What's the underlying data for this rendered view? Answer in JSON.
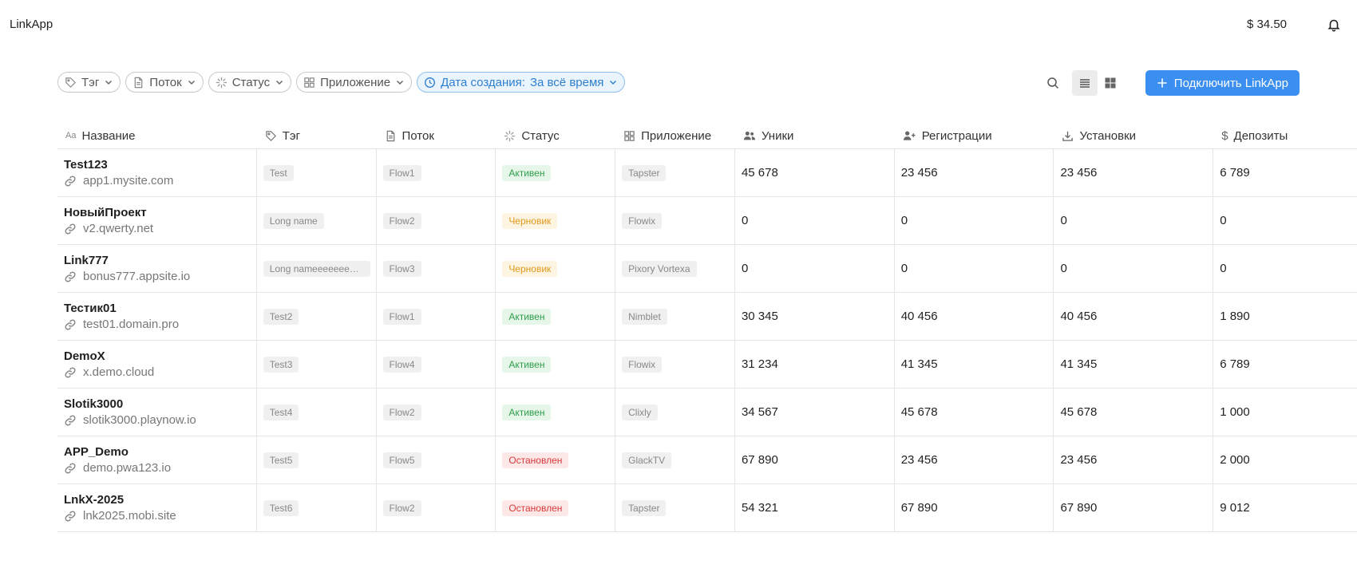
{
  "app": {
    "title": "LinkApp",
    "balance": "$ 34.50"
  },
  "filters": [
    {
      "label": "Тэг",
      "icon": "tag-icon"
    },
    {
      "label": "Поток",
      "icon": "document-icon"
    },
    {
      "label": "Статус",
      "icon": "loader-icon"
    },
    {
      "label": "Приложение",
      "icon": "grid-icon"
    }
  ],
  "date_filter": {
    "label": "Дата создания:",
    "value": "За всё время",
    "icon": "clock-icon"
  },
  "toolbar": {
    "connect_label": "Подключить LinkApp"
  },
  "columns": {
    "name": "Название",
    "tag": "Тэг",
    "flow": "Поток",
    "status": "Статус",
    "app": "Приложение",
    "uniques": "Уники",
    "registrations": "Регистрации",
    "installs": "Установки",
    "deposits": "Депозиты"
  },
  "rows": [
    {
      "name": "Test123",
      "url": "app1.mysite.com",
      "tag": "Test",
      "flow": "Flow1",
      "status": "Активен",
      "status_kind": "active",
      "app": "Tapster",
      "uniques": "45 678",
      "registrations": "23 456",
      "installs": "23 456",
      "deposits": "6 789"
    },
    {
      "name": "НовыйПроект",
      "url": "v2.qwerty.net",
      "tag": "Long name",
      "flow": "Flow2",
      "status": "Черновик",
      "status_kind": "draft",
      "app": "Flowix",
      "uniques": "0",
      "registrations": "0",
      "installs": "0",
      "deposits": "0"
    },
    {
      "name": "Link777",
      "url": "bonus777.appsite.io",
      "tag": "Long nameeeeeeeeeeeee",
      "flow": "Flow3",
      "status": "Черновик",
      "status_kind": "draft",
      "app": "Pixory Vortexa",
      "uniques": "0",
      "registrations": "0",
      "installs": "0",
      "deposits": "0"
    },
    {
      "name": "Тестик01",
      "url": "test01.domain.pro",
      "tag": "Test2",
      "flow": "Flow1",
      "status": "Активен",
      "status_kind": "active",
      "app": "Nimblet",
      "uniques": "30 345",
      "registrations": "40 456",
      "installs": "40 456",
      "deposits": "1 890"
    },
    {
      "name": "DemoX",
      "url": "x.demo.cloud",
      "tag": "Test3",
      "flow": "Flow4",
      "status": "Активен",
      "status_kind": "active",
      "app": "Flowix",
      "uniques": "31 234",
      "registrations": "41 345",
      "installs": "41 345",
      "deposits": "6 789"
    },
    {
      "name": "Slotik3000",
      "url": "slotik3000.playnow.io",
      "tag": "Test4",
      "flow": "Flow2",
      "status": "Активен",
      "status_kind": "active",
      "app": "Clixly",
      "uniques": "34 567",
      "registrations": "45 678",
      "installs": "45 678",
      "deposits": "1 000"
    },
    {
      "name": "APP_Demo",
      "url": "demo.pwa123.io",
      "tag": "Test5",
      "flow": "Flow5",
      "status": "Остановлен",
      "status_kind": "stopped",
      "app": "GlackTV",
      "uniques": "67 890",
      "registrations": "23 456",
      "installs": "23 456",
      "deposits": "2 000"
    },
    {
      "name": "LnkX-2025",
      "url": "lnk2025.mobi.site",
      "tag": "Test6",
      "flow": "Flow2",
      "status": "Остановлен",
      "status_kind": "stopped",
      "app": "Tapster",
      "uniques": "54 321",
      "registrations": "67 890",
      "installs": "67 890",
      "deposits": "9 012"
    }
  ],
  "colors": {
    "accent": "#3b8ff0",
    "active": "#2f9e4b",
    "draft": "#e09a1b",
    "stopped": "#d9383a"
  }
}
